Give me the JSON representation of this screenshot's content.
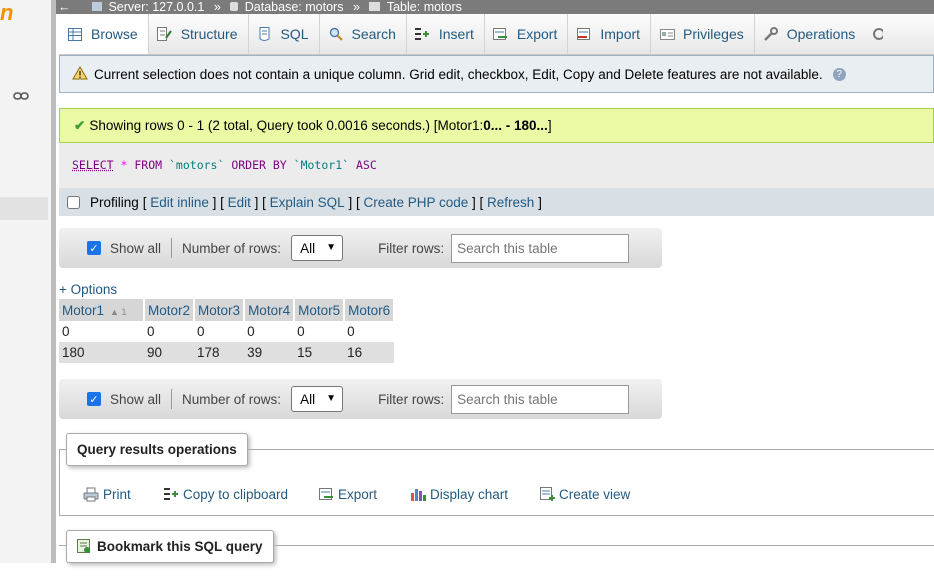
{
  "breadcrumb": {
    "back_arrow": "←",
    "server": "Server: 127.0.0.1",
    "database": "Database: motors",
    "table": "Table: motors",
    "separator": "»"
  },
  "left_logo_fragment": "n",
  "tabs": [
    {
      "label": "Browse",
      "icon": "browse-icon",
      "active": true
    },
    {
      "label": "Structure",
      "icon": "structure-icon",
      "active": false
    },
    {
      "label": "SQL",
      "icon": "sql-icon",
      "active": false
    },
    {
      "label": "Search",
      "icon": "search-icon",
      "active": false
    },
    {
      "label": "Insert",
      "icon": "insert-icon",
      "active": false
    },
    {
      "label": "Export",
      "icon": "export-icon",
      "active": false
    },
    {
      "label": "Import",
      "icon": "import-icon",
      "active": false
    },
    {
      "label": "Privileges",
      "icon": "privileges-icon",
      "active": false
    },
    {
      "label": "Operations",
      "icon": "operations-icon",
      "active": false
    }
  ],
  "notice": {
    "text": "Current selection does not contain a unique column. Grid edit, checkbox, Edit, Copy and Delete features are not available."
  },
  "success": {
    "text_prefix": "Showing rows 0 - 1 (2 total, Query took 0.0016 seconds.) [Motor1: ",
    "text_bold": "0... - 180...",
    "text_suffix": "]"
  },
  "sql": {
    "select": "SELECT",
    "star": "*",
    "from": "FROM",
    "table": "`motors`",
    "order_by": "ORDER BY",
    "column": "`Motor1`",
    "asc": "ASC"
  },
  "profiling": {
    "label": "Profiling",
    "links": [
      "Edit inline",
      "Edit",
      "Explain SQL",
      "Create PHP code",
      "Refresh"
    ]
  },
  "navbar": {
    "show_all": "Show all",
    "number_of_rows": "Number of rows:",
    "rows_value": "All",
    "filter_rows": "Filter rows:",
    "search_placeholder": "Search this table"
  },
  "options_link": "+ Options",
  "table": {
    "sort_marker": "1",
    "columns": [
      "Motor1",
      "Motor2",
      "Motor3",
      "Motor4",
      "Motor5",
      "Motor6"
    ],
    "rows": [
      [
        "0",
        "0",
        "0",
        "0",
        "0",
        "0"
      ],
      [
        "180",
        "90",
        "178",
        "39",
        "15",
        "16"
      ]
    ]
  },
  "query_results_operations": {
    "title": "Query results operations",
    "links": [
      {
        "label": "Print",
        "icon": "print-icon"
      },
      {
        "label": "Copy to clipboard",
        "icon": "copy-icon"
      },
      {
        "label": "Export",
        "icon": "export-icon"
      },
      {
        "label": "Display chart",
        "icon": "chart-icon"
      },
      {
        "label": "Create view",
        "icon": "view-icon"
      }
    ]
  },
  "bookmark": {
    "title": "Bookmark this SQL query"
  },
  "colors": {
    "link": "#235a81",
    "success_bg": "#ebf8a4",
    "notice_bg": "#e9eef3",
    "brand_orange": "#f39200"
  }
}
